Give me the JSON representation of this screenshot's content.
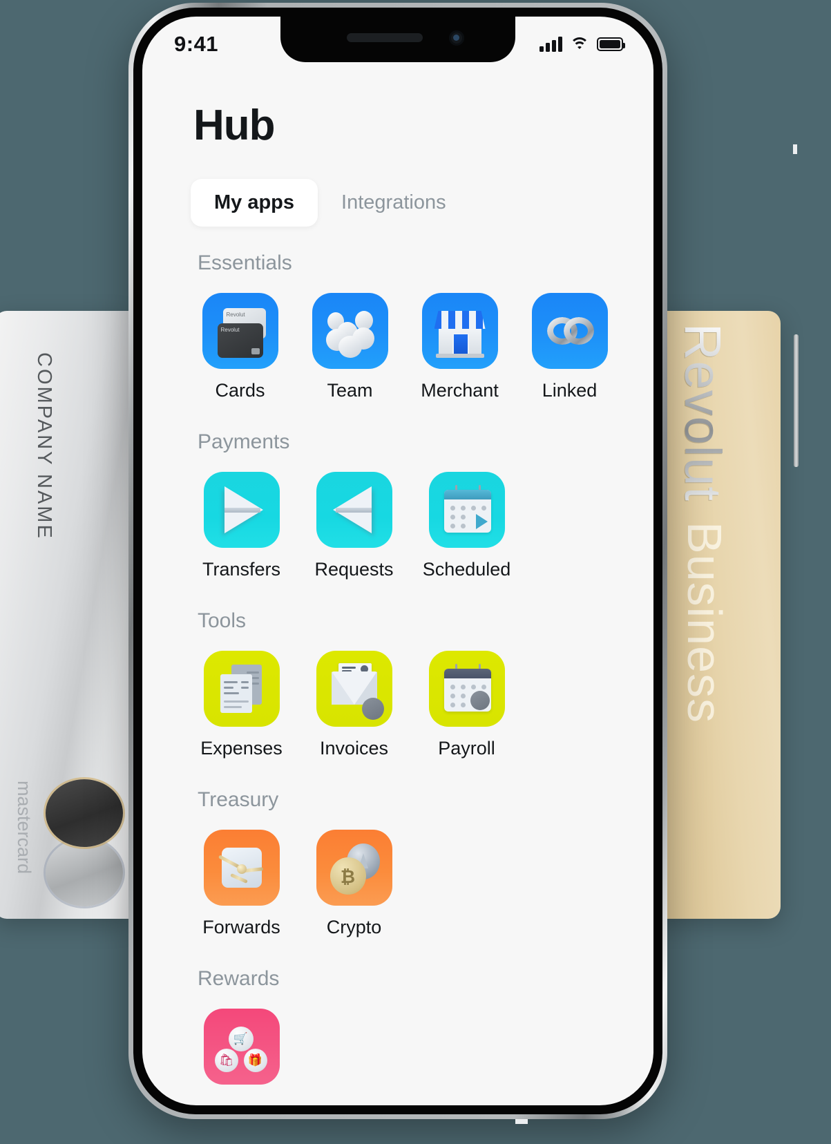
{
  "background_color": "#4d6870",
  "status_bar": {
    "time": "9:41",
    "signal_icon": "cellular-bars-icon",
    "wifi_icon": "wifi-icon",
    "battery_icon": "battery-icon"
  },
  "header": {
    "title": "Hub"
  },
  "tabs": [
    {
      "label": "My apps",
      "active": true
    },
    {
      "label": "Integrations",
      "active": false
    }
  ],
  "sections": [
    {
      "title": "Essentials",
      "color": "#1d8ff8",
      "apps": [
        {
          "label": "Cards",
          "icon": "cards-icon",
          "tile": "blue"
        },
        {
          "label": "Team",
          "icon": "people-icon",
          "tile": "blue"
        },
        {
          "label": "Merchant",
          "icon": "storefront-icon",
          "tile": "blue"
        },
        {
          "label": "Linked",
          "icon": "chain-link-icon",
          "tile": "blue"
        }
      ]
    },
    {
      "title": "Payments",
      "color": "#17d8e2",
      "apps": [
        {
          "label": "Transfers",
          "icon": "paper-plane-right-icon",
          "tile": "cyan"
        },
        {
          "label": "Requests",
          "icon": "paper-plane-left-icon",
          "tile": "cyan"
        },
        {
          "label": "Scheduled",
          "icon": "calendar-play-icon",
          "tile": "cyan"
        }
      ]
    },
    {
      "title": "Tools",
      "color": "#d8e400",
      "apps": [
        {
          "label": "Expenses",
          "icon": "receipts-icon",
          "tile": "lime"
        },
        {
          "label": "Invoices",
          "icon": "envelope-document-icon",
          "tile": "lime"
        },
        {
          "label": "Payroll",
          "icon": "calendar-person-icon",
          "tile": "lime"
        }
      ]
    },
    {
      "title": "Treasury",
      "color": "#fb8c3c",
      "apps": [
        {
          "label": "Forwards",
          "icon": "forward-contract-icon",
          "tile": "orange"
        },
        {
          "label": "Crypto",
          "icon": "crypto-coins-icon",
          "tile": "orange"
        }
      ]
    },
    {
      "title": "Rewards",
      "color": "#f5628c",
      "apps": [
        {
          "label": "",
          "icon": "rewards-balls-icon",
          "tile": "pink"
        }
      ]
    }
  ],
  "cards": {
    "left": {
      "company_name": "COMPANY NAME",
      "network": "mastercard",
      "network_logo_icon": "mastercard-logo-icon"
    },
    "right": {
      "brand": "Revolut",
      "product": "Business"
    }
  },
  "card_icon_labels": {
    "brand": "Revolut"
  }
}
